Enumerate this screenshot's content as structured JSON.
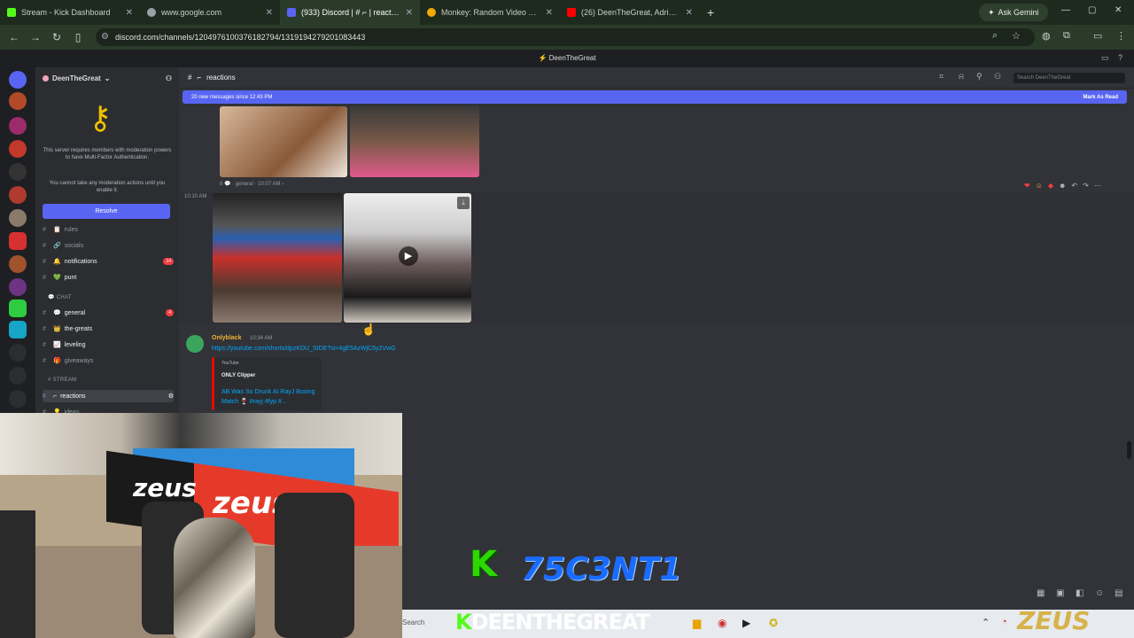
{
  "browser": {
    "tabs": [
      {
        "title": "Stream - Kick Dashboard",
        "color": "#53fc18"
      },
      {
        "title": "www.google.com",
        "color": "#9aa0a6"
      },
      {
        "title": "(933) Discord | # ⌐ | reactions",
        "color": "#5865f2"
      },
      {
        "title": "Monkey: Random Video Chat |",
        "color": "#f2a900"
      },
      {
        "title": "(26) DeenTheGreat, Adrien Bro",
        "color": "#ff0000"
      }
    ],
    "new_tab": "+",
    "gemini": "Ask Gemini",
    "url": "discord.com/channels/1204976100376182794/1319194279201083443"
  },
  "discord": {
    "window_title": "DeenTheGreat",
    "server_name": "DeenTheGreat",
    "mfa_text": "This server requires members with moderation powers to have Multi-Factor Authentication.",
    "mfa_text2": "You cannot take any moderation actions until you enable it.",
    "resolve": "Resolve",
    "channels": [
      {
        "name": "rules",
        "icon": "📋",
        "style": "muted"
      },
      {
        "name": "socials",
        "icon": "🔗",
        "style": "muted"
      },
      {
        "name": "notifications",
        "icon": "🔔",
        "style": "bold",
        "badge": "14"
      },
      {
        "name": "punt",
        "icon": "💚",
        "style": "bold"
      }
    ],
    "cat_chat": "CHAT",
    "chat_channels": [
      {
        "name": "general",
        "icon": "💬",
        "style": "bold",
        "badge": "4"
      },
      {
        "name": "the-greats",
        "icon": "👑",
        "style": "bold"
      },
      {
        "name": "leveling",
        "icon": "📈",
        "style": "bold"
      },
      {
        "name": "giveaways",
        "icon": "🎁",
        "style": "muted"
      }
    ],
    "cat_stream": "STREAM",
    "stream_channels": [
      {
        "name": "reactions",
        "icon": "⌐",
        "style": "active"
      },
      {
        "name": "ideas",
        "icon": "💡",
        "style": "muted"
      }
    ],
    "channel_header": "reactions",
    "search_placeholder": "Search DeenTheGreat",
    "new_messages": "20 new messages since 12:43 PM",
    "mark_as_read": "Mark As Read",
    "thread_meta": "8 💬 · general · 10:07 AM ›",
    "time_left": "10:10 AM",
    "msg_user": "Onlyblack",
    "msg_time": "10:34 AM",
    "msg_link": "https://youtube.com/shorts/dpzKDU_SIDE?si=4gE5AzWjC5y2VwG",
    "embed_provider": "YouTube",
    "embed_author": "ONLY Clipper",
    "embed_title": "AB Was So Drunk At RayJ Boxing Match 🍷 #rayj #fyp #..."
  },
  "overlay": {
    "kick_k": "K",
    "kick_name": "75C3NT1",
    "streamer_k": "K",
    "streamer_name": "DEENTHEGREAT",
    "zeus": "ZEUS",
    "sign_text": "zeus",
    "search": "Search"
  }
}
